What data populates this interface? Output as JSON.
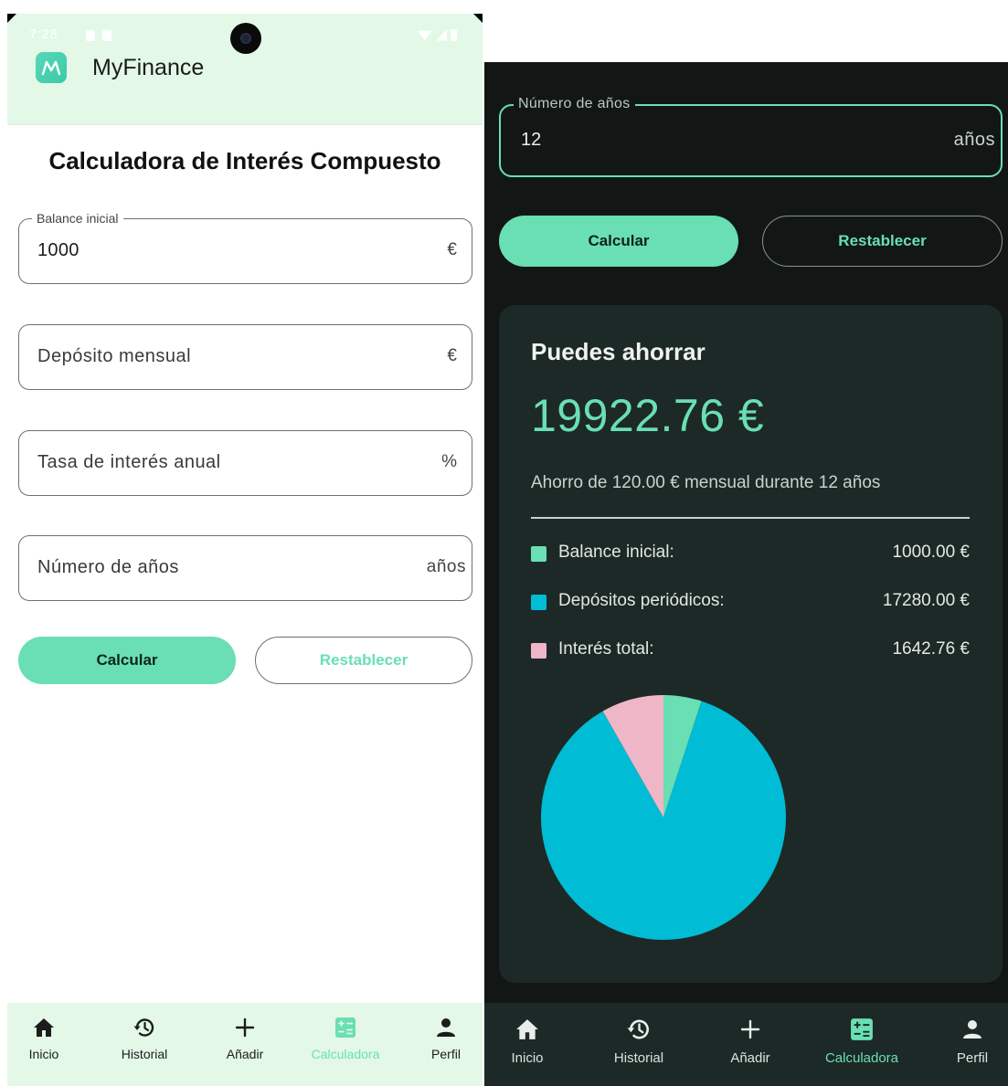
{
  "status_bar": {
    "time": "7:28"
  },
  "app": {
    "name": "MyFinance",
    "logo_glyph": "M"
  },
  "light_screen": {
    "title": "Calculadora de Interés Compuesto",
    "fields": {
      "initial_balance": {
        "label": "Balance inicial",
        "value": "1000",
        "suffix": "€"
      },
      "monthly_deposit": {
        "placeholder": "Depósito mensual",
        "suffix": "€"
      },
      "annual_rate": {
        "placeholder": "Tasa de interés anual",
        "suffix": "%"
      },
      "years": {
        "placeholder": "Número de años",
        "suffix": "años"
      }
    },
    "buttons": {
      "calculate": "Calcular",
      "reset": "Restablecer"
    }
  },
  "dark_screen": {
    "years_field": {
      "label": "Número de años",
      "value": "12",
      "suffix": "años"
    },
    "buttons": {
      "calculate": "Calcular",
      "reset": "Restablecer"
    },
    "result": {
      "heading": "Puedes ahorrar",
      "amount": "19922.76 €",
      "summary": "Ahorro de 120.00 € mensual durante 12 años",
      "breakdown": [
        {
          "label": "Balance inicial:",
          "value": "1000.00 €",
          "color": "#69dfb3"
        },
        {
          "label": "Depósitos periódicos:",
          "value": "17280.00 €",
          "color": "#00bcd4"
        },
        {
          "label": "Interés total:",
          "value": "1642.76 €",
          "color": "#efb6c7"
        }
      ]
    }
  },
  "chart_data": {
    "type": "pie",
    "categories": [
      "Balance inicial",
      "Depósitos periódicos",
      "Interés total"
    ],
    "values": [
      1000.0,
      17280.0,
      1642.76
    ],
    "colors": [
      "#69dfb3",
      "#00bcd4",
      "#efb6c7"
    ],
    "start_angle": "12 o'clock",
    "direction": "clockwise"
  },
  "nav": {
    "items": [
      {
        "label": "Inicio",
        "icon": "home-icon"
      },
      {
        "label": "Historial",
        "icon": "history-icon"
      },
      {
        "label": "Añadir",
        "icon": "add-icon"
      },
      {
        "label": "Calculadora",
        "icon": "calculator-icon",
        "active": true
      },
      {
        "label": "Perfil",
        "icon": "person-icon"
      }
    ]
  },
  "colors": {
    "accent": "#69dfb3",
    "light_bar": "#e3f8e7",
    "dark_bg": "#121715",
    "dark_card": "#1d2926"
  }
}
